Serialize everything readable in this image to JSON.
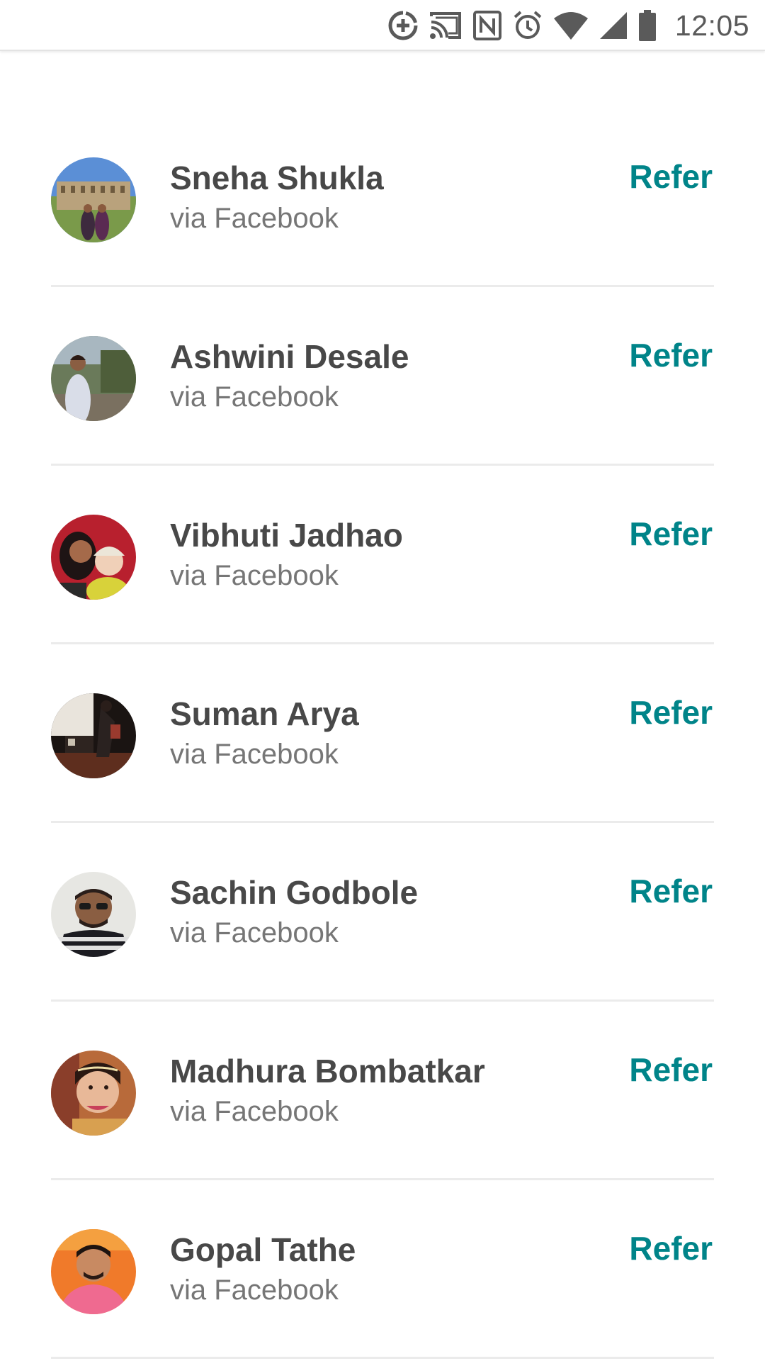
{
  "status_bar": {
    "time": "12:05",
    "icons": [
      "data-saver-icon",
      "cast-icon",
      "nfc-icon",
      "alarm-icon",
      "wifi-icon",
      "cellular-signal-icon",
      "battery-icon"
    ]
  },
  "contacts": [
    {
      "name": "Sneha Shukla",
      "source": "via Facebook",
      "action": "Refer"
    },
    {
      "name": "Ashwini Desale",
      "source": "via Facebook",
      "action": "Refer"
    },
    {
      "name": "Vibhuti Jadhao",
      "source": "via Facebook",
      "action": "Refer"
    },
    {
      "name": "Suman Arya",
      "source": "via Facebook",
      "action": "Refer"
    },
    {
      "name": "Sachin Godbole",
      "source": "via Facebook",
      "action": "Refer"
    },
    {
      "name": "Madhura Bombatkar",
      "source": "via Facebook",
      "action": "Refer"
    },
    {
      "name": "Gopal Tathe",
      "source": "via Facebook",
      "action": "Refer"
    }
  ],
  "colors": {
    "accent": "#008489",
    "name_text": "#484848",
    "secondary_text": "#767676",
    "divider": "#ebebeb"
  }
}
